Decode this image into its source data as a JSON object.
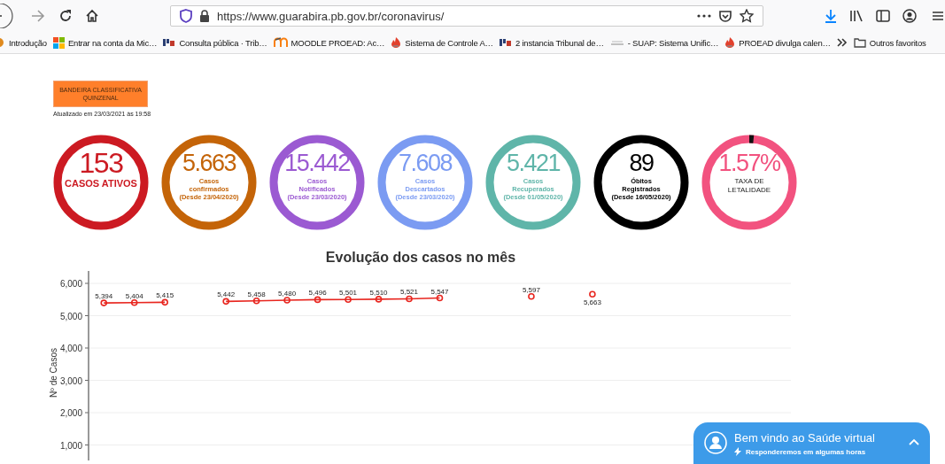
{
  "browser": {
    "url": "https://www.guarabira.pb.gov.br/coronavirus/",
    "bookmarks": [
      {
        "label": "Introdução"
      },
      {
        "label": "Entrar na conta da Mic…"
      },
      {
        "label": "Consulta pública · Trib…"
      },
      {
        "label": "MOODLE PROEAD: Ac…"
      },
      {
        "label": "Sistema de Controle A…"
      },
      {
        "label": "2 instancia Tribunal de…"
      },
      {
        "label": "- SUAP: Sistema Unific…"
      },
      {
        "label": "PROEAD divulga calen…"
      }
    ],
    "other_bookmarks": "Outros favoritos"
  },
  "page": {
    "flag_button": "BANDEIRA CLASSIFICATIVA QUINZENAL",
    "updated": "Atualizado em 23/03/2021 às 19:58",
    "stats": [
      {
        "value": "153",
        "lines": [
          "CASOS ATIVOS"
        ],
        "color": "#cc1a22",
        "kind": "big"
      },
      {
        "value": "5.663",
        "lines": [
          "Casos",
          "confirmados",
          "(Desde 23/04/2020)"
        ],
        "color": "#c46408",
        "kind": "small"
      },
      {
        "value": "15.442",
        "lines": [
          "Casos",
          "Notificados",
          "(Desde 23/03/2020)"
        ],
        "color": "#9b5ad2",
        "kind": "small"
      },
      {
        "value": "7.608",
        "lines": [
          "Casos",
          "Descartados",
          "(Desde 23/03/2020)"
        ],
        "color": "#7b9bf2",
        "kind": "small"
      },
      {
        "value": "5.421",
        "lines": [
          "Casos",
          "Recuperados",
          "(Desde 01/05/2020)"
        ],
        "color": "#5fb5a9",
        "kind": "small"
      },
      {
        "value": "89",
        "lines": [
          "Óbitos",
          "Registrados",
          "(Desde 16/05/2020)"
        ],
        "color": "#000000",
        "kind": "small"
      },
      {
        "value": "1.57%",
        "lines": [
          "TAXA DE",
          "LETALIDADE"
        ],
        "color": "#f2527f",
        "kind": "rate"
      }
    ],
    "chart_title": "Evolução dos casos no mês",
    "chart_data": {
      "type": "line",
      "ylabel": "Nº de Casos",
      "ylim": [
        521,
        6000
      ],
      "grid": true,
      "yticks": [
        {
          "value": 1000,
          "label": "1,000"
        },
        {
          "value": 2000,
          "label": "2,000"
        },
        {
          "value": 3000,
          "label": "3,000"
        },
        {
          "value": 4000,
          "label": "4,000"
        },
        {
          "value": 5000,
          "label": "5,000"
        },
        {
          "value": 6000,
          "label": "6,000"
        }
      ],
      "series": [
        {
          "color": "#e8261f",
          "marker": "circle",
          "values": [
            5394,
            5404,
            5415,
            null,
            5442,
            5458,
            5480,
            5496,
            5501,
            5510,
            5521,
            5547,
            null,
            null,
            5597,
            null,
            5663,
            null,
            null,
            null,
            null,
            null,
            null
          ],
          "value_labels": [
            "5,394",
            "5,404",
            "5,415",
            null,
            "5,442",
            "5,458",
            "5,480",
            "5,496",
            "5,501",
            "5,510",
            "5,521",
            "5,547",
            null,
            null,
            "5,597",
            null,
            "5,663",
            null,
            null,
            null,
            null,
            null,
            null
          ]
        }
      ]
    }
  },
  "chat": {
    "title": "Bem vindo ao Saúde virtual",
    "subtitle": "Responderemos em algumas horas"
  }
}
